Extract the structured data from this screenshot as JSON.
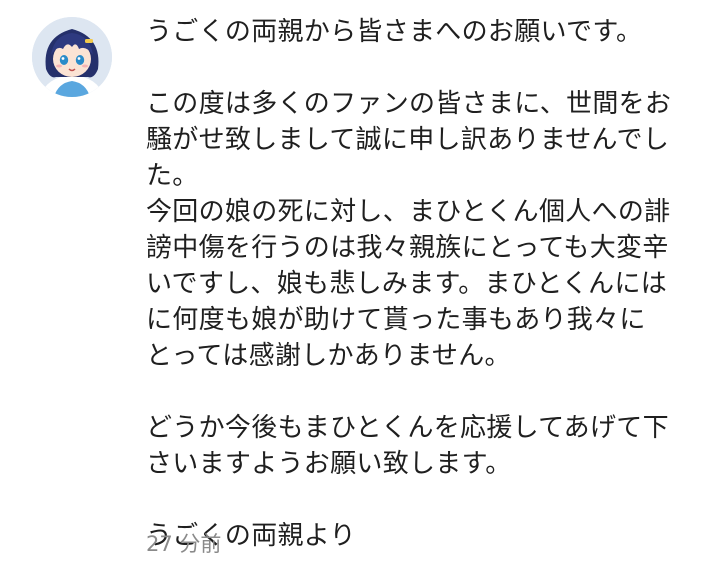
{
  "comment": {
    "avatar_icon": "anime-avatar-icon",
    "greeting": "うごくの両親から皆さまへのお願いです。",
    "paragraph1": [
      "この度は多くのファンの皆さまに、世間をお",
      "騒がせ致しまして誠に申し訳ありませんでし",
      "た。"
    ],
    "paragraph2": [
      "今回の娘の死に対し、まひとくん個人への誹",
      "謗中傷を行うのは我々親族にとっても大変辛",
      "いですし、娘も悲しみます。まひとくんには",
      "に何度も娘が助けて貰った事もあり我々に",
      "とっては感謝しかありません。"
    ],
    "paragraph3": [
      "どうか今後もまひとくんを応援してあげて下",
      "さいますようお願い致します。"
    ],
    "signature": "うごくの両親より",
    "timestamp": "27 分前"
  }
}
